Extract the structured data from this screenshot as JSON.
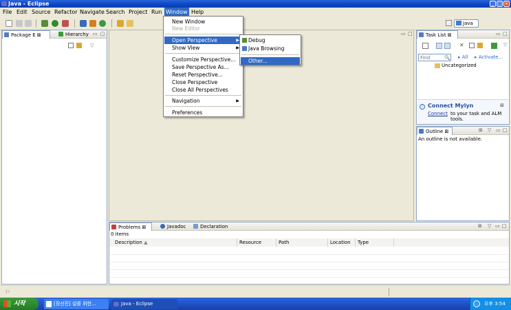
{
  "window": {
    "title": "Java - Eclipse"
  },
  "menubar": {
    "items": [
      "File",
      "Edit",
      "Source",
      "Refactor",
      "Navigate",
      "Search",
      "Project",
      "Run",
      "Window",
      "Help"
    ],
    "active": "Window"
  },
  "window_menu": {
    "items": [
      "New Window",
      "New Editor",
      "Open Perspective",
      "Show View",
      "Customize Perspective...",
      "Save Perspective As...",
      "Reset Perspective...",
      "Close Perspective",
      "Close All Perspectives",
      "Navigation",
      "Preferences"
    ]
  },
  "perspective_submenu": {
    "items": [
      "Debug",
      "Java Browsing",
      "Other..."
    ]
  },
  "perspective_switcher": {
    "current": "Java"
  },
  "package_view": {
    "tabs": [
      "Package E",
      "Hierarchy"
    ]
  },
  "task_list": {
    "title": "Task List",
    "find_placeholder": "Find",
    "filter_all": "All",
    "activate": "Activate...",
    "category": "Uncategorized",
    "mylyn_title": "Connect Mylyn",
    "mylyn_link": "Connect",
    "mylyn_text": " to your task and ALM tools."
  },
  "outline": {
    "title": "Outline",
    "message": "An outline is not available."
  },
  "problems": {
    "tabs": [
      "Problems",
      "Javadoc",
      "Declaration"
    ],
    "count": "0 items",
    "columns": [
      "Description",
      "Resource",
      "Path",
      "Location",
      "Type"
    ]
  },
  "taskbar": {
    "start": "시작",
    "items": [
      "[장선진] 설를 위한...",
      "Java - Eclipse"
    ],
    "clock": "오후 3:54"
  },
  "colors": {
    "accent": "#316ac5",
    "titlebar": "#0b46c4",
    "taskbar": "#245edb",
    "start": "#2f8c2f"
  }
}
